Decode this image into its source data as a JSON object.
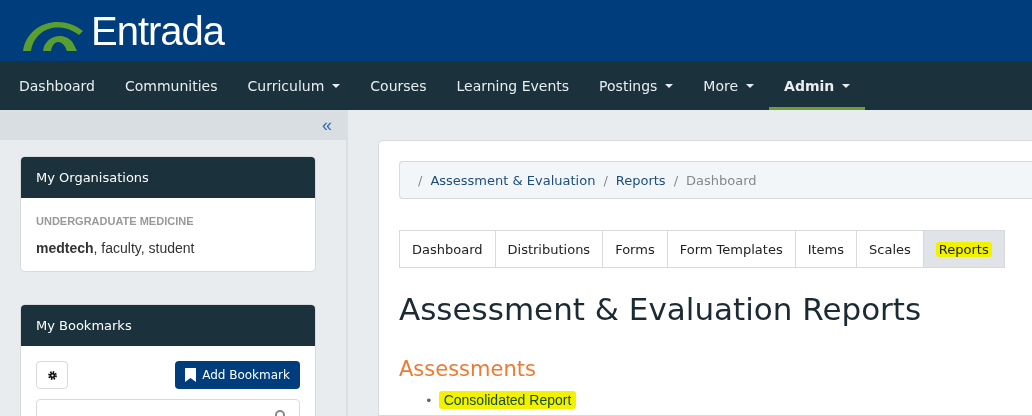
{
  "header": {
    "logo_text": "Entrada"
  },
  "nav": [
    {
      "label": "Dashboard",
      "dropdown": false,
      "selected": false
    },
    {
      "label": "Communities",
      "dropdown": false,
      "selected": false
    },
    {
      "label": "Curriculum",
      "dropdown": true,
      "selected": false
    },
    {
      "label": "Courses",
      "dropdown": false,
      "selected": false
    },
    {
      "label": "Learning Events",
      "dropdown": false,
      "selected": false
    },
    {
      "label": "Postings",
      "dropdown": true,
      "selected": false
    },
    {
      "label": "More",
      "dropdown": true,
      "selected": false
    },
    {
      "label": "Admin",
      "dropdown": true,
      "selected": true
    }
  ],
  "sidebar": {
    "collapse": "«",
    "organisations": {
      "title": "My Organisations",
      "group": "UNDERGRADUATE MEDICINE",
      "roles": "**medtech**, faculty, student"
    },
    "bookmarks": {
      "title": "My Bookmarks",
      "add_button": "Add Bookmark"
    }
  },
  "breadcrumb": [
    {
      "separator": "/",
      "label": "Assessment & Evaluation",
      "link": true
    },
    {
      "separator": "/",
      "label": "Reports",
      "link": true
    },
    {
      "separator": "/",
      "label": "Dashboard",
      "link": false
    }
  ],
  "tabs": [
    {
      "label": "Dashboard",
      "selected": false,
      "highlighted": false
    },
    {
      "label": "Distributions",
      "selected": false,
      "highlighted": false
    },
    {
      "label": "Forms",
      "selected": false,
      "highlighted": false
    },
    {
      "label": "Form Templates",
      "selected": false,
      "highlighted": false
    },
    {
      "label": "Items",
      "selected": false,
      "highlighted": false
    },
    {
      "label": "Scales",
      "selected": false,
      "highlighted": false
    },
    {
      "label": "Reports",
      "selected": true,
      "highlighted": true
    }
  ],
  "page_title": "Assessment & Evaluation Reports",
  "section": {
    "title": "Assessments",
    "links": [
      {
        "bullet": "•",
        "label": "Consolidated Report",
        "highlighted": true
      }
    ]
  }
}
